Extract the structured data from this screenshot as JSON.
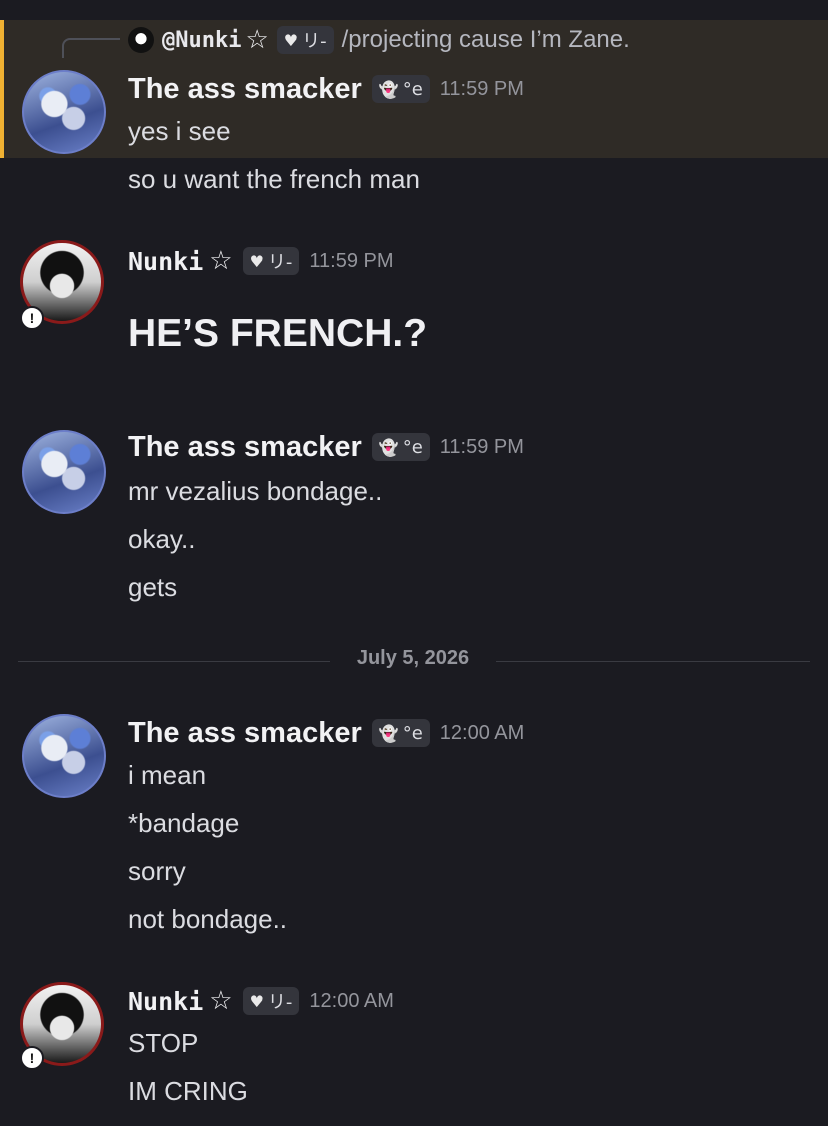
{
  "reply": {
    "username": "@Nunki",
    "star": "☆",
    "tag_text": "リ-",
    "tag_icon": "heart-icon",
    "text": "/projecting cause I’m Zane."
  },
  "users": {
    "smacker": {
      "name": "The ass smacker",
      "tag_text": "°e",
      "tag_icon": "ghost-icon"
    },
    "nunki": {
      "name": "Nunki",
      "star": "☆",
      "tag_text": "リ-",
      "tag_icon": "heart-icon",
      "badge": "!"
    }
  },
  "messages": [
    {
      "user": "smacker",
      "time": "11:59 PM",
      "lines": [
        "yes i see",
        "so u want the french man"
      ]
    },
    {
      "user": "nunki",
      "time": "11:59 PM",
      "lines": [
        "HE’S FRENCH.?"
      ]
    },
    {
      "user": "smacker",
      "time": "11:59 PM",
      "lines": [
        "mr vezalius bondage..",
        "okay..",
        "gets"
      ]
    },
    {
      "user": "smacker",
      "time": "12:00 AM",
      "lines": [
        "i mean",
        "*bandage",
        "sorry",
        "not bondage.."
      ]
    },
    {
      "user": "nunki",
      "time": "12:00 AM",
      "lines": [
        "STOP",
        "IM CRING"
      ]
    }
  ],
  "date_divider": "July 5, 2026",
  "colors": {
    "background": "#1b1b21",
    "mention_highlight": "#2f2b26",
    "mention_bar": "#f0b132",
    "timestamp": "#94959c"
  }
}
